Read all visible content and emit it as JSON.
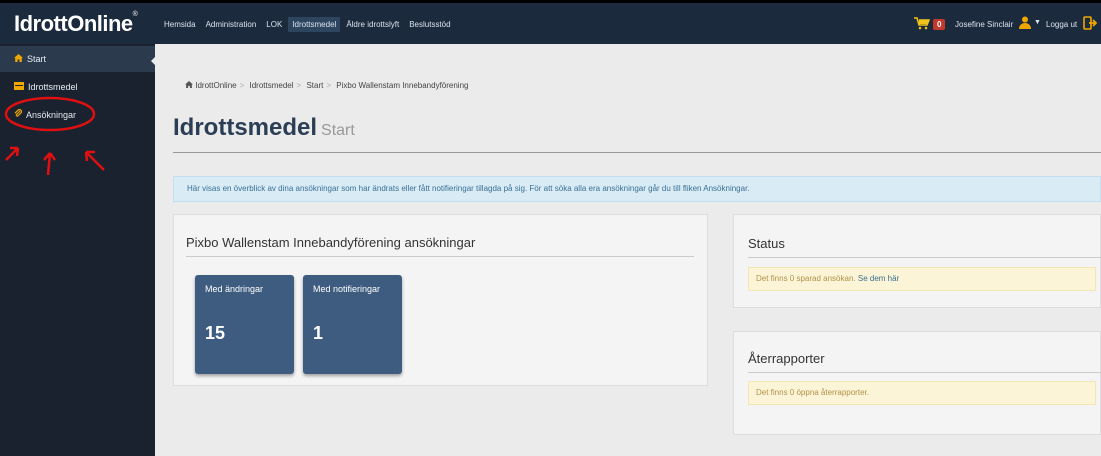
{
  "app": {
    "logo": "IdrottOnline",
    "logo_mark": "®"
  },
  "topnav": {
    "items": [
      {
        "label": "Hemsida"
      },
      {
        "label": "Administration"
      },
      {
        "label": "LOK"
      },
      {
        "label": "Idrottsmedel"
      },
      {
        "label": "Äldre idrottslyft"
      },
      {
        "label": "Beslutsstöd"
      }
    ],
    "active_index": 3
  },
  "user": {
    "cart_count": "0",
    "name": "Josefine Sinclair",
    "logout_label": "Logga ut"
  },
  "sidebar": {
    "items": [
      {
        "label": "Start",
        "icon": "home-icon"
      },
      {
        "label": "Idrottsmedel",
        "icon": "folder-icon"
      },
      {
        "label": "Ansökningar",
        "icon": "paperclip-icon"
      }
    ]
  },
  "breadcrumb": {
    "items": [
      "IdrottOnline",
      "Idrottsmedel",
      "Start",
      "Pixbo Wallenstam Innebandyförening"
    ]
  },
  "page": {
    "title": "Idrottsmedel",
    "subtitle": "Start"
  },
  "info_bar": {
    "text": "Här visas en överblick av dina ansökningar som har ändrats eller fått notifieringar tillagda på sig. För att söka alla era ansökningar går du till fliken Ansökningar."
  },
  "applications_panel": {
    "title": "Pixbo Wallenstam Innebandyförening ansökningar",
    "tiles": [
      {
        "label": "Med ändringar",
        "value": "15"
      },
      {
        "label": "Med notifieringar",
        "value": "1"
      }
    ]
  },
  "status_panel": {
    "title": "Status",
    "message": "Det finns 0 sparad ansökan.",
    "link": "Se dem här"
  },
  "reports_panel": {
    "title": "Återrapporter",
    "message": "Det finns 0 öppna återrapporter."
  },
  "colors": {
    "topbar": "#1c2a3d",
    "sidebar": "#1a2230",
    "tile": "#3e5c80",
    "annotation": "#e01010"
  }
}
